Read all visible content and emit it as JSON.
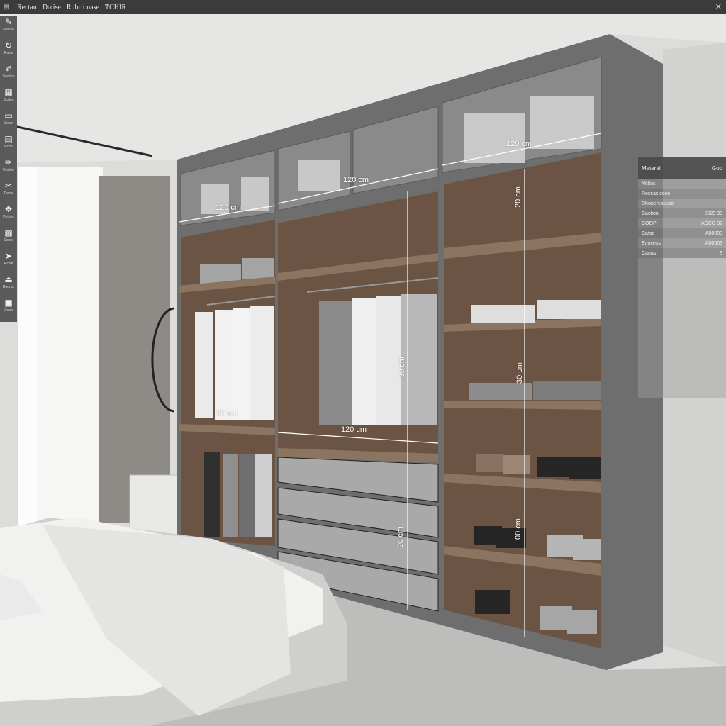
{
  "menu": {
    "items": [
      "Rectan",
      "Dotise",
      "Rubrfonase",
      "TCHIR"
    ],
    "close_icon": "close-icon"
  },
  "toolbar": {
    "tools": [
      {
        "icon": "pencil-square-icon",
        "glyph": "✎",
        "label": "Rasise"
      },
      {
        "icon": "rotate-icon",
        "glyph": "↻",
        "label": "Rutre"
      },
      {
        "icon": "eraser-icon",
        "glyph": "✐",
        "label": "Soution"
      },
      {
        "icon": "grid-icon",
        "glyph": "▦",
        "label": "Scales"
      },
      {
        "icon": "monitor-icon",
        "glyph": "▭",
        "label": "Scoon"
      },
      {
        "icon": "layout-icon",
        "glyph": "▤",
        "label": "Ecoo"
      },
      {
        "icon": "pen-icon",
        "glyph": "✏",
        "label": "Ooaloe"
      },
      {
        "icon": "scissors-icon",
        "glyph": "✂",
        "label": "Toone"
      },
      {
        "icon": "move-icon",
        "glyph": "✥",
        "label": "Pnthes"
      },
      {
        "icon": "hatch-icon",
        "glyph": "▩",
        "label": "Soose"
      },
      {
        "icon": "select-icon",
        "glyph": "➤",
        "label": "Rcise"
      },
      {
        "icon": "stamp-icon",
        "glyph": "⏏",
        "label": "Doonor"
      },
      {
        "icon": "gallery-icon",
        "glyph": "▣",
        "label": "Eoose"
      }
    ]
  },
  "material_panel": {
    "title": "Materail",
    "title_value": "Goo",
    "rows": [
      {
        "label": "Ntiltos",
        "value": "",
        "style": "plain"
      },
      {
        "label": "Rossas coce",
        "value": "",
        "style": "alt"
      },
      {
        "label": "Dhonerescuso",
        "value": "",
        "style": "plain"
      },
      {
        "label": "Caction",
        "value": "8029 33",
        "style": "alt"
      },
      {
        "label": "COOP",
        "value": "ACCO 32",
        "style": "plain"
      },
      {
        "label": "Catse",
        "value": "A00003",
        "style": "alt"
      },
      {
        "label": "Enocess",
        "value": "A00503",
        "style": "plain"
      },
      {
        "label": "Canas",
        "value": "E",
        "style": "alt"
      }
    ]
  },
  "dimensions": {
    "top_left": "120 cm",
    "top_mid": "120 cm",
    "top_right": "120 cm",
    "right_top": "20 cm",
    "right_mid": "30 cm",
    "right_bottom": "00 cm",
    "center_vertical": "20 cm",
    "center_hanging": "30 cm",
    "left_hanging": "30 cm",
    "mid_width": "120 cm"
  },
  "colors": {
    "frame": "#6e6e6e",
    "wood": "#6b5443",
    "drawer": "#a9a9a9",
    "wall": "#dcdcda",
    "floor": "#b7b7b5"
  }
}
